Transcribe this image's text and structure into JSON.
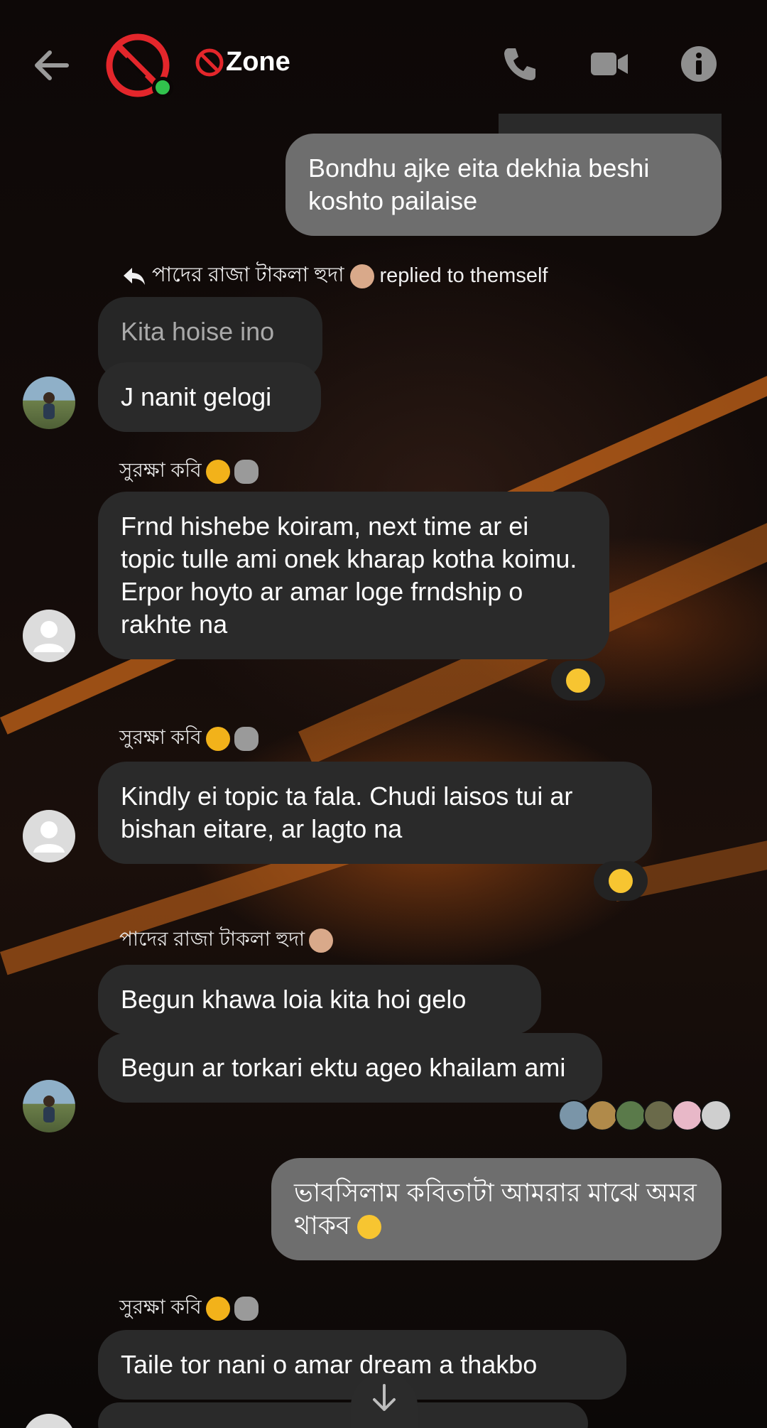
{
  "header": {
    "title": "Zone",
    "online": true
  },
  "messages": {
    "outgoing_1": "Bondhu ajke eita dekhia beshi koshto pailaise",
    "reply_note": {
      "sender": "পাদের রাজা টাকলা হুদা",
      "text": "replied to themself"
    },
    "quoted_reply": "Kita hoise ino",
    "reply_text": "J nanit gelogi",
    "sender_kobi_1": "সুরক্ষা কবি",
    "kobi_msg_1": "Frnd hishebe koiram, next time ar ei topic tulle ami onek kharap kotha koimu. Erpor hoyto ar amar loge frndship o rakhte na",
    "reaction_1": "😮",
    "sender_kobi_2": "সুরক্ষা কবি",
    "kobi_msg_2": "Kindly ei topic ta fala. Chudi laisos tui ar bishan eitare, ar lagto na",
    "reaction_2": "😢",
    "sender_huda": "পাদের রাজা টাকলা হুদা",
    "huda_msg_1": "Begun khawa loia kita hoi gelo",
    "huda_msg_2": "Begun ar torkari ektu ageo khailam ami",
    "outgoing_2": "ভাবসিলাম কবিতাটা আমরার মাঝে অমর থাকব",
    "sender_kobi_3": "সুরক্ষা কবি",
    "kobi_msg_3": "Taile tor nani o amar dream a thakbo"
  },
  "colors": {
    "outgoing_bubble": "#6e6e6e",
    "incoming_bubble": "#2a2a2a",
    "online": "#31c24d",
    "block_red": "#e3262b",
    "accent_orange": "#c8661a"
  },
  "icons": [
    "back-arrow-icon",
    "phone-icon",
    "video-call-icon",
    "info-icon",
    "reply-arrow-icon",
    "scroll-down-icon"
  ]
}
